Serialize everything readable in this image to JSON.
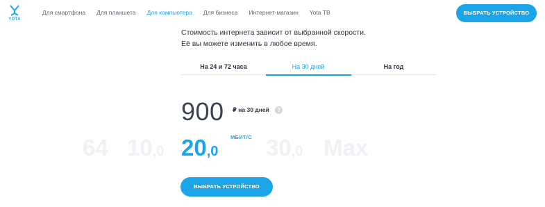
{
  "header": {
    "logo_text": "YOTA",
    "nav": [
      {
        "label": "Для смартфона"
      },
      {
        "label": "Для планшета"
      },
      {
        "label": "Для компьютера"
      },
      {
        "label": "Для бизнеса"
      },
      {
        "label": "Интернет-магазин"
      },
      {
        "label": "Yota ТВ"
      }
    ],
    "active_nav_index": 2,
    "button_label": "ВЫБРАТЬ УСТРОЙСТВО"
  },
  "description": {
    "line1": "Стоимость интернета зависит от выбранной скорости.",
    "line2": "Её вы можете изменить в любое время."
  },
  "tabs": [
    {
      "label": "На 24 и 72 часа"
    },
    {
      "label": "На 30 дней"
    },
    {
      "label": "На год"
    }
  ],
  "active_tab_index": 1,
  "price": {
    "amount": "900",
    "period": "₽ на 30 дней",
    "info_icon": "?"
  },
  "speeds": [
    {
      "int": "64",
      "frac": ""
    },
    {
      "int": "10",
      "frac": ",0"
    },
    {
      "int": "20",
      "frac": ",0"
    },
    {
      "int": "30",
      "frac": ",0"
    },
    {
      "int": "Max",
      "frac": ""
    }
  ],
  "selected_speed_index": 2,
  "speed_unit": "МБИТ/С",
  "main_button_label": "ВЫБРАТЬ УСТРОЙСТВО",
  "colors": {
    "accent": "#1ba5e8",
    "text": "#2b3340",
    "faded": "#eff1f4"
  }
}
